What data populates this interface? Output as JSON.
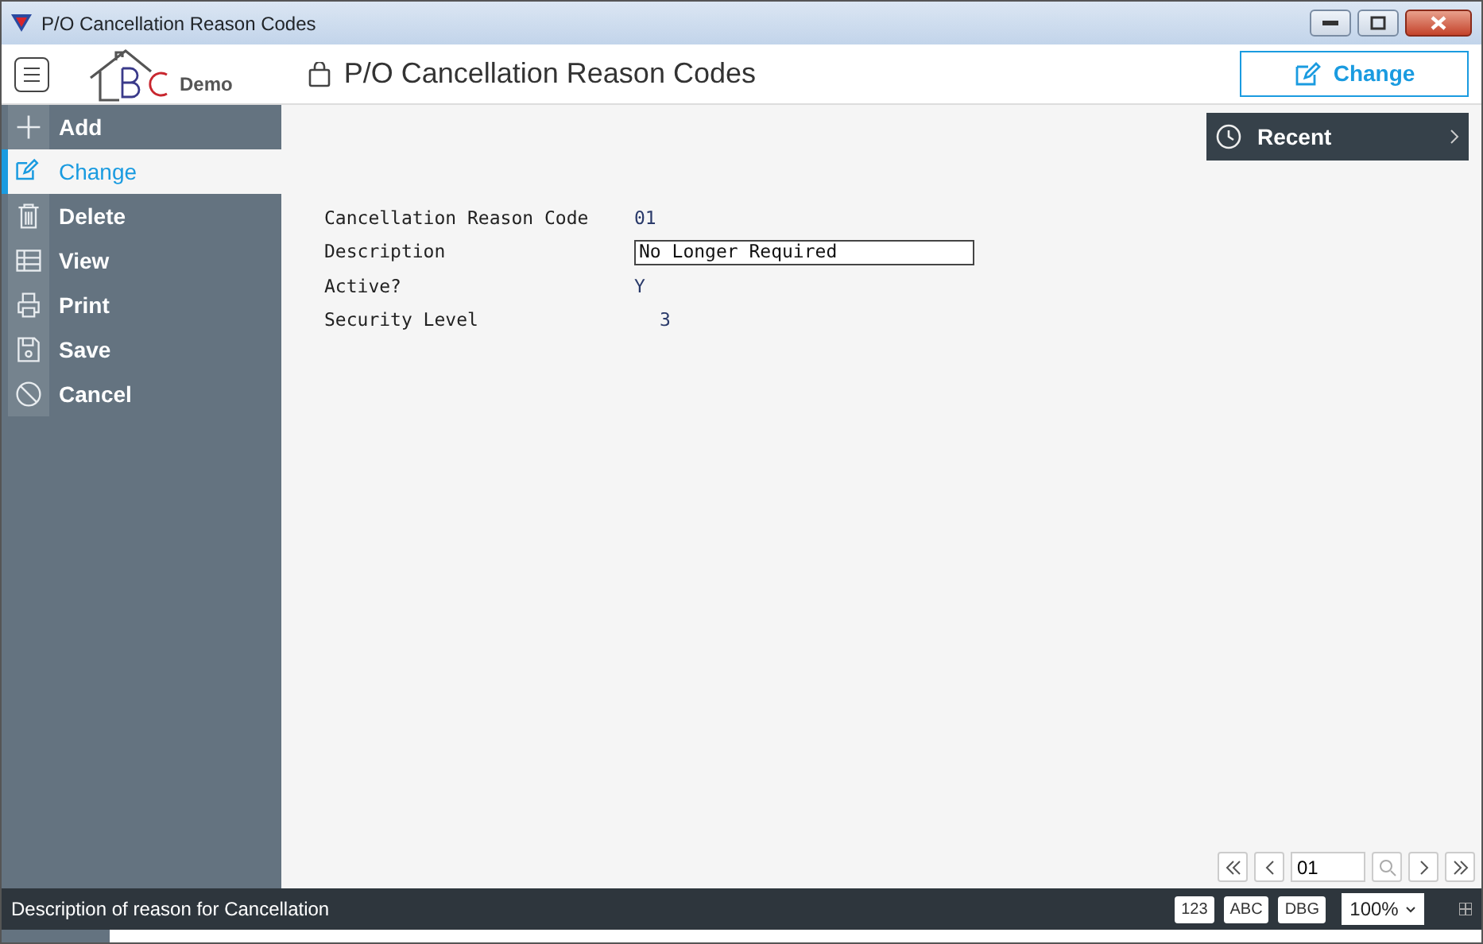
{
  "window": {
    "title": "P/O Cancellation Reason Codes"
  },
  "header": {
    "logo_text": "Demo",
    "page_title": "P/O Cancellation Reason Codes",
    "action_button": "Change"
  },
  "sidebar": {
    "items": [
      {
        "label": "Add",
        "kind": "add",
        "selected": false
      },
      {
        "label": "Change",
        "kind": "change",
        "selected": true
      },
      {
        "label": "Delete",
        "kind": "delete",
        "selected": false
      },
      {
        "label": "View",
        "kind": "view",
        "selected": false
      },
      {
        "label": "Print",
        "kind": "print",
        "selected": false
      },
      {
        "label": "Save",
        "kind": "save",
        "selected": false
      },
      {
        "label": "Cancel",
        "kind": "cancel",
        "selected": false
      }
    ]
  },
  "recent": {
    "label": "Recent"
  },
  "form": {
    "fields": [
      {
        "label": "Cancellation Reason Code",
        "value": "01",
        "kind": "text"
      },
      {
        "label": "Description",
        "value": "No Longer Required",
        "kind": "input"
      },
      {
        "label": "Active?",
        "value": "Y",
        "kind": "text"
      },
      {
        "label": "Security Level",
        "value": "3",
        "kind": "number"
      }
    ]
  },
  "navigator": {
    "value": "01"
  },
  "status_bar": {
    "message": "Description of reason for Cancellation",
    "badges": [
      "123",
      "ABC",
      "DBG"
    ],
    "zoom": "100%"
  }
}
